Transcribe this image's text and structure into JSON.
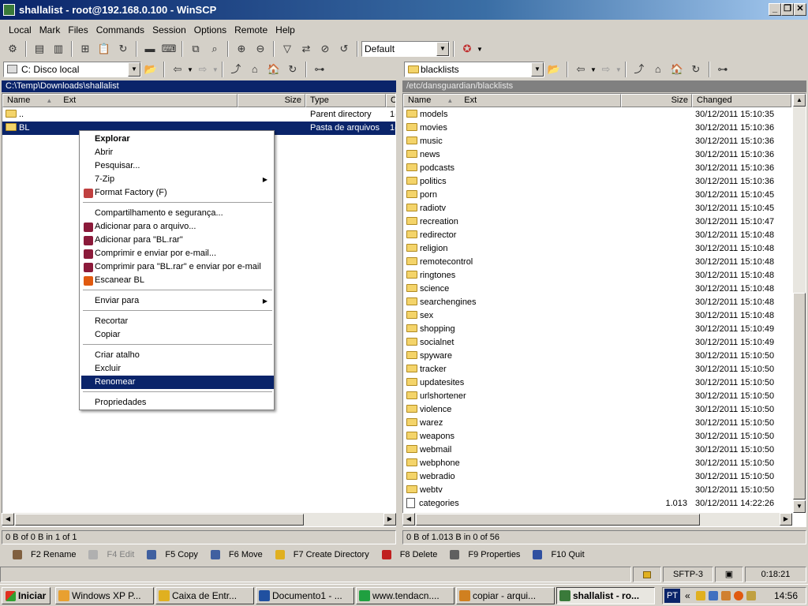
{
  "window": {
    "title": "shallalist - root@192.168.0.100 - WinSCP"
  },
  "menu": [
    "Local",
    "Mark",
    "Files",
    "Commands",
    "Session",
    "Options",
    "Remote",
    "Help"
  ],
  "toolbar": {
    "profile": "Default"
  },
  "left": {
    "drive": "C: Disco local",
    "path": "C:\\Temp\\Downloads\\shallalist",
    "columns": {
      "name": "Name",
      "ext": "Ext",
      "size": "Size",
      "type": "Type",
      "changed": "C"
    },
    "rows": [
      {
        "name": "..",
        "type": "Parent directory",
        "changed": "1("
      },
      {
        "name": "BL",
        "type": "Pasta de arquivos",
        "changed": "1("
      }
    ],
    "status": "0 B of 0 B in 1 of 1"
  },
  "right": {
    "dir": "blacklists",
    "path": "/etc/dansguardian/blacklists",
    "columns": {
      "name": "Name",
      "ext": "Ext",
      "size": "Size",
      "changed": "Changed"
    },
    "rows": [
      {
        "name": "models",
        "size": "",
        "changed": "30/12/2011 15:10:35"
      },
      {
        "name": "movies",
        "size": "",
        "changed": "30/12/2011 15:10:36"
      },
      {
        "name": "music",
        "size": "",
        "changed": "30/12/2011 15:10:36"
      },
      {
        "name": "news",
        "size": "",
        "changed": "30/12/2011 15:10:36"
      },
      {
        "name": "podcasts",
        "size": "",
        "changed": "30/12/2011 15:10:36"
      },
      {
        "name": "politics",
        "size": "",
        "changed": "30/12/2011 15:10:36"
      },
      {
        "name": "porn",
        "size": "",
        "changed": "30/12/2011 15:10:45"
      },
      {
        "name": "radiotv",
        "size": "",
        "changed": "30/12/2011 15:10:45"
      },
      {
        "name": "recreation",
        "size": "",
        "changed": "30/12/2011 15:10:47"
      },
      {
        "name": "redirector",
        "size": "",
        "changed": "30/12/2011 15:10:48"
      },
      {
        "name": "religion",
        "size": "",
        "changed": "30/12/2011 15:10:48"
      },
      {
        "name": "remotecontrol",
        "size": "",
        "changed": "30/12/2011 15:10:48"
      },
      {
        "name": "ringtones",
        "size": "",
        "changed": "30/12/2011 15:10:48"
      },
      {
        "name": "science",
        "size": "",
        "changed": "30/12/2011 15:10:48"
      },
      {
        "name": "searchengines",
        "size": "",
        "changed": "30/12/2011 15:10:48"
      },
      {
        "name": "sex",
        "size": "",
        "changed": "30/12/2011 15:10:48"
      },
      {
        "name": "shopping",
        "size": "",
        "changed": "30/12/2011 15:10:49"
      },
      {
        "name": "socialnet",
        "size": "",
        "changed": "30/12/2011 15:10:49"
      },
      {
        "name": "spyware",
        "size": "",
        "changed": "30/12/2011 15:10:50"
      },
      {
        "name": "tracker",
        "size": "",
        "changed": "30/12/2011 15:10:50"
      },
      {
        "name": "updatesites",
        "size": "",
        "changed": "30/12/2011 15:10:50"
      },
      {
        "name": "urlshortener",
        "size": "",
        "changed": "30/12/2011 15:10:50"
      },
      {
        "name": "violence",
        "size": "",
        "changed": "30/12/2011 15:10:50"
      },
      {
        "name": "warez",
        "size": "",
        "changed": "30/12/2011 15:10:50"
      },
      {
        "name": "weapons",
        "size": "",
        "changed": "30/12/2011 15:10:50"
      },
      {
        "name": "webmail",
        "size": "",
        "changed": "30/12/2011 15:10:50"
      },
      {
        "name": "webphone",
        "size": "",
        "changed": "30/12/2011 15:10:50"
      },
      {
        "name": "webradio",
        "size": "",
        "changed": "30/12/2011 15:10:50"
      },
      {
        "name": "webtv",
        "size": "",
        "changed": "30/12/2011 15:10:50"
      },
      {
        "name": "categories",
        "size": "1.013",
        "changed": "30/12/2011 14:22:26",
        "file": true
      }
    ],
    "status": "0 B of 1.013 B in 0 of 56"
  },
  "context_menu": {
    "items": [
      {
        "label": "Explorar",
        "bold": true
      },
      {
        "label": "Abrir"
      },
      {
        "label": "Pesquisar..."
      },
      {
        "label": "7-Zip",
        "sub": true
      },
      {
        "label": "Format Factory (F)",
        "icon": "format-factory-icon",
        "color": "#c04040"
      },
      {
        "sep": true
      },
      {
        "label": "Compartilhamento e segurança..."
      },
      {
        "label": "Adicionar para o arquivo...",
        "icon": "winrar-icon",
        "color": "#8b1a3a"
      },
      {
        "label": "Adicionar para \"BL.rar\"",
        "icon": "winrar-icon",
        "color": "#8b1a3a"
      },
      {
        "label": "Comprimir e enviar por e-mail...",
        "icon": "winrar-icon",
        "color": "#8b1a3a"
      },
      {
        "label": "Comprimir para \"BL.rar\" e enviar por e-mail",
        "icon": "winrar-icon",
        "color": "#8b1a3a"
      },
      {
        "label": "Escanear BL",
        "icon": "antivirus-icon",
        "color": "#e05a10"
      },
      {
        "sep": true
      },
      {
        "label": "Enviar para",
        "sub": true
      },
      {
        "sep": true
      },
      {
        "label": "Recortar"
      },
      {
        "label": "Copiar"
      },
      {
        "sep": true
      },
      {
        "label": "Criar atalho"
      },
      {
        "label": "Excluir"
      },
      {
        "label": "Renomear",
        "selected": true
      },
      {
        "sep": true
      },
      {
        "label": "Propriedades"
      }
    ]
  },
  "fkeys": [
    {
      "label": "F2 Rename",
      "icon": "rename-icon",
      "enabled": true
    },
    {
      "label": "F4 Edit",
      "icon": "edit-icon",
      "enabled": false
    },
    {
      "label": "F5 Copy",
      "icon": "copy-icon",
      "enabled": true
    },
    {
      "label": "F6 Move",
      "icon": "move-icon",
      "enabled": true
    },
    {
      "label": "F7 Create Directory",
      "icon": "new-folder-icon",
      "enabled": true
    },
    {
      "label": "F8 Delete",
      "icon": "delete-icon",
      "enabled": true
    },
    {
      "label": "F9 Properties",
      "icon": "properties-icon",
      "enabled": true
    },
    {
      "label": "F10 Quit",
      "icon": "quit-icon",
      "enabled": true
    }
  ],
  "status": {
    "protocol": "SFTP-3",
    "elapsed": "0:18:21"
  },
  "taskbar": {
    "start": "Iniciar",
    "tasks": [
      {
        "label": "Windows XP P...",
        "color": "#e8a030"
      },
      {
        "label": "Caixa de Entr...",
        "color": "#e0b020"
      },
      {
        "label": "Documento1 - ...",
        "color": "#2050a0"
      },
      {
        "label": "www.tendacn....",
        "color": "#20a040"
      },
      {
        "label": "copiar - arqui...",
        "color": "#d08020"
      },
      {
        "label": "shallalist - ro...",
        "color": "#3a7a3a",
        "active": true
      }
    ],
    "lang": "PT",
    "clock": "14:56"
  },
  "colors": {
    "selection": "#0a246a",
    "title_start": "#0a246a",
    "title_end": "#a6caf0"
  }
}
